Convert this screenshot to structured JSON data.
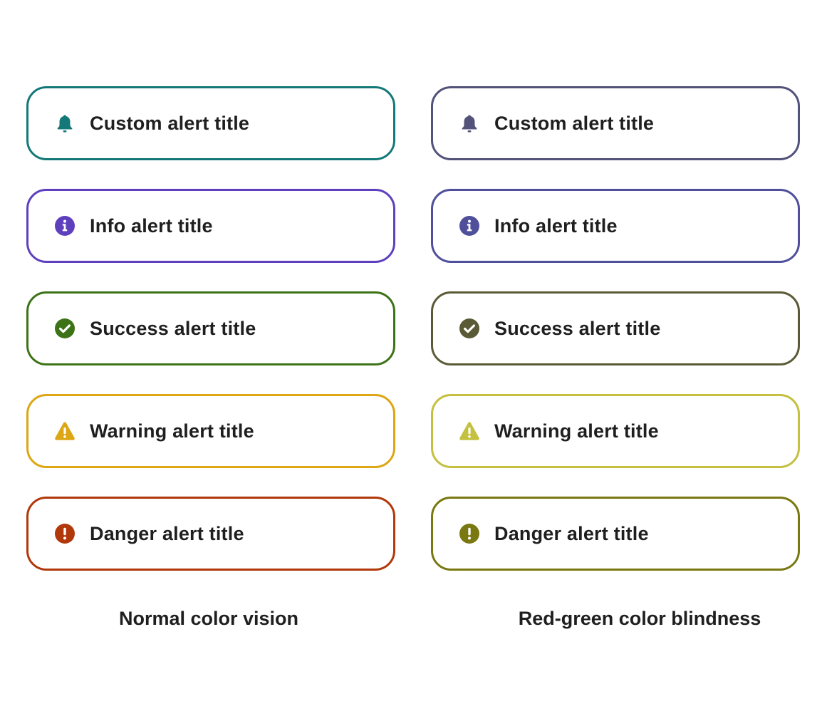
{
  "columns": [
    {
      "caption": "Normal color vision",
      "alerts": [
        {
          "type": "custom",
          "icon": "bell-icon",
          "title": "Custom alert title",
          "color": "#147878"
        },
        {
          "type": "info",
          "icon": "info-circle-icon",
          "title": "Info alert title",
          "color": "#5e40be"
        },
        {
          "type": "success",
          "icon": "check-circle-icon",
          "title": "Success alert title",
          "color": "#3d7317"
        },
        {
          "type": "warning",
          "icon": "warning-triangle-icon",
          "title": "Warning alert title",
          "color": "#dca614"
        },
        {
          "type": "danger",
          "icon": "exclamation-circle-icon",
          "title": "Danger alert title",
          "color": "#b1380b"
        }
      ]
    },
    {
      "caption": "Red-green color blindness",
      "alerts": [
        {
          "type": "custom",
          "icon": "bell-icon",
          "title": "Custom alert title",
          "color": "#52527a"
        },
        {
          "type": "info",
          "icon": "info-circle-icon",
          "title": "Info alert title",
          "color": "#4f4f9c"
        },
        {
          "type": "success",
          "icon": "check-circle-icon",
          "title": "Success alert title",
          "color": "#5a5a36"
        },
        {
          "type": "warning",
          "icon": "warning-triangle-icon",
          "title": "Warning alert title",
          "color": "#c4c040"
        },
        {
          "type": "danger",
          "icon": "exclamation-circle-icon",
          "title": "Danger alert title",
          "color": "#7a7810"
        }
      ]
    }
  ]
}
